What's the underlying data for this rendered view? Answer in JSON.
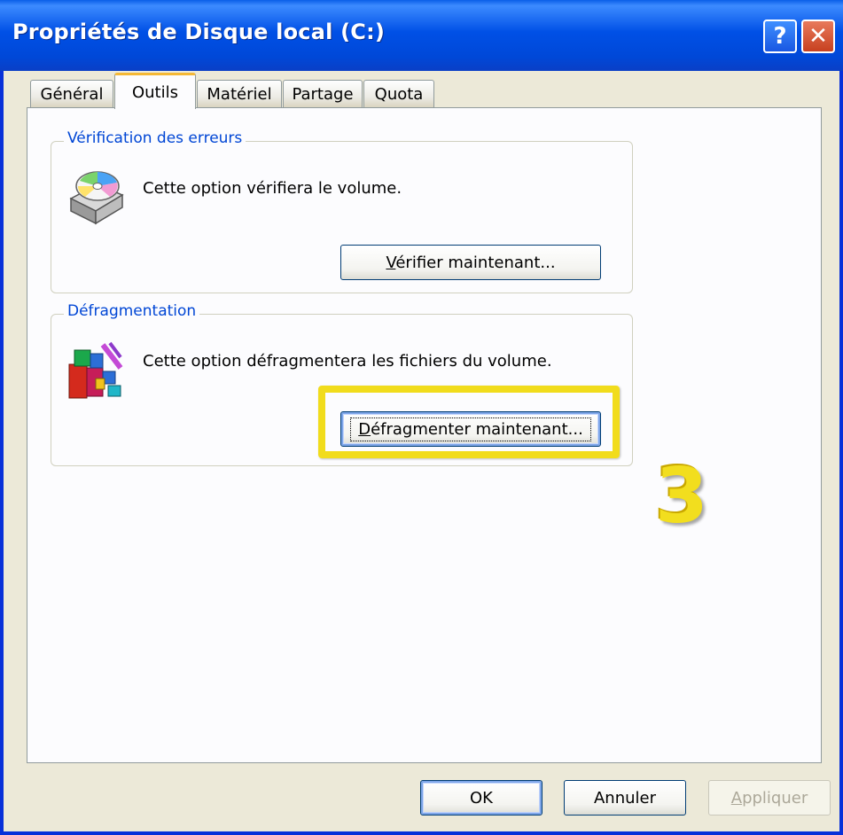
{
  "window": {
    "title": "Propriétés de Disque local (C:)",
    "help_glyph": "?",
    "close_glyph": "✕"
  },
  "tabs": [
    {
      "label": "Général",
      "active": false
    },
    {
      "label": "Outils",
      "active": true
    },
    {
      "label": "Matériel",
      "active": false
    },
    {
      "label": "Partage",
      "active": false
    },
    {
      "label": "Quota",
      "active": false
    }
  ],
  "error_check": {
    "legend": "Vérification des erreurs",
    "description": "Cette option vérifiera le volume.",
    "button_prefix": "V",
    "button_rest": "érifier maintenant..."
  },
  "defrag": {
    "legend": "Défragmentation",
    "description": "Cette option défragmentera les fichiers du volume.",
    "button_prefix": "D",
    "button_rest": "éfragmenter maintenant..."
  },
  "annotation": {
    "step_number": "3",
    "highlight_color": "#f1dc1c"
  },
  "footer": {
    "ok_label": "OK",
    "cancel_label": "Annuler",
    "apply_prefix": "A",
    "apply_rest": "ppliquer"
  },
  "icons": {
    "check_disk": "disk-check-icon",
    "defrag": "defrag-icon"
  }
}
